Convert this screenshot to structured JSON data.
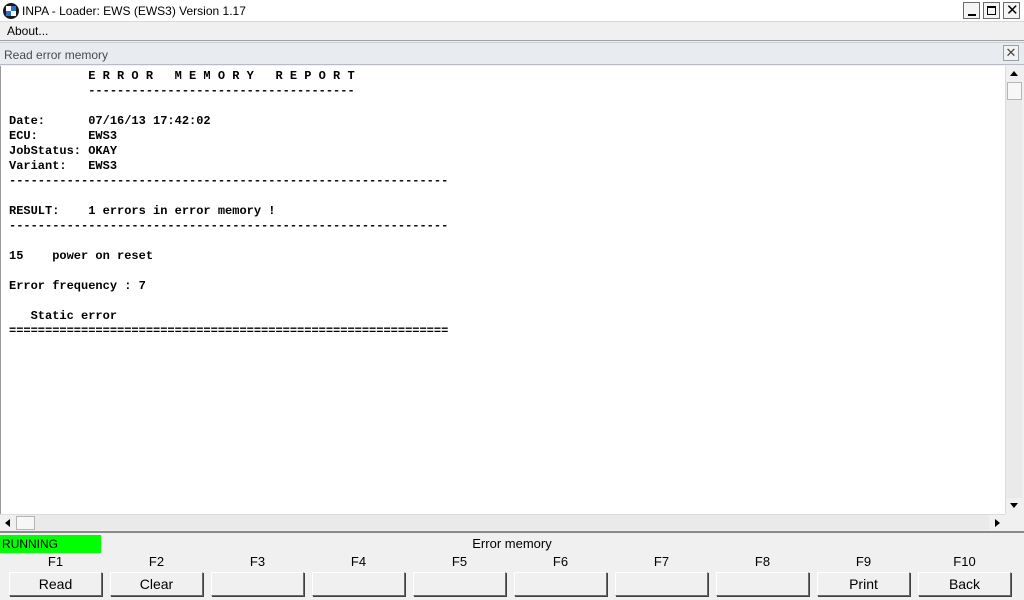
{
  "window": {
    "title": "INPA - Loader:  EWS (EWS3) Version 1.17",
    "app_icon": "bmw-logo-icon"
  },
  "menu": {
    "items": [
      {
        "label": "About..."
      }
    ]
  },
  "child_window": {
    "title": "Read error memory"
  },
  "report": {
    "lines": [
      "           E R R O R   M E M O R Y   R E P O R T",
      "           -------------------------------------",
      "",
      "Date:      07/16/13 17:42:02",
      "ECU:       EWS3",
      "JobStatus: OKAY",
      "Variant:   EWS3",
      "-------------------------------------------------------------",
      "",
      "RESULT:    1 errors in error memory !",
      "-------------------------------------------------------------",
      "",
      "15    power on reset",
      "",
      "Error frequency : 7",
      "",
      "   Static error",
      "============================================================="
    ]
  },
  "status": {
    "state": "RUNNING",
    "state_color": "#00ff00",
    "panel_title": "Error memory"
  },
  "function_keys": [
    {
      "key": "F1",
      "label": "Read"
    },
    {
      "key": "F2",
      "label": "Clear"
    },
    {
      "key": "F3",
      "label": ""
    },
    {
      "key": "F4",
      "label": ""
    },
    {
      "key": "F5",
      "label": ""
    },
    {
      "key": "F6",
      "label": ""
    },
    {
      "key": "F7",
      "label": ""
    },
    {
      "key": "F8",
      "label": ""
    },
    {
      "key": "F9",
      "label": "Print"
    },
    {
      "key": "F10",
      "label": "Back"
    }
  ]
}
